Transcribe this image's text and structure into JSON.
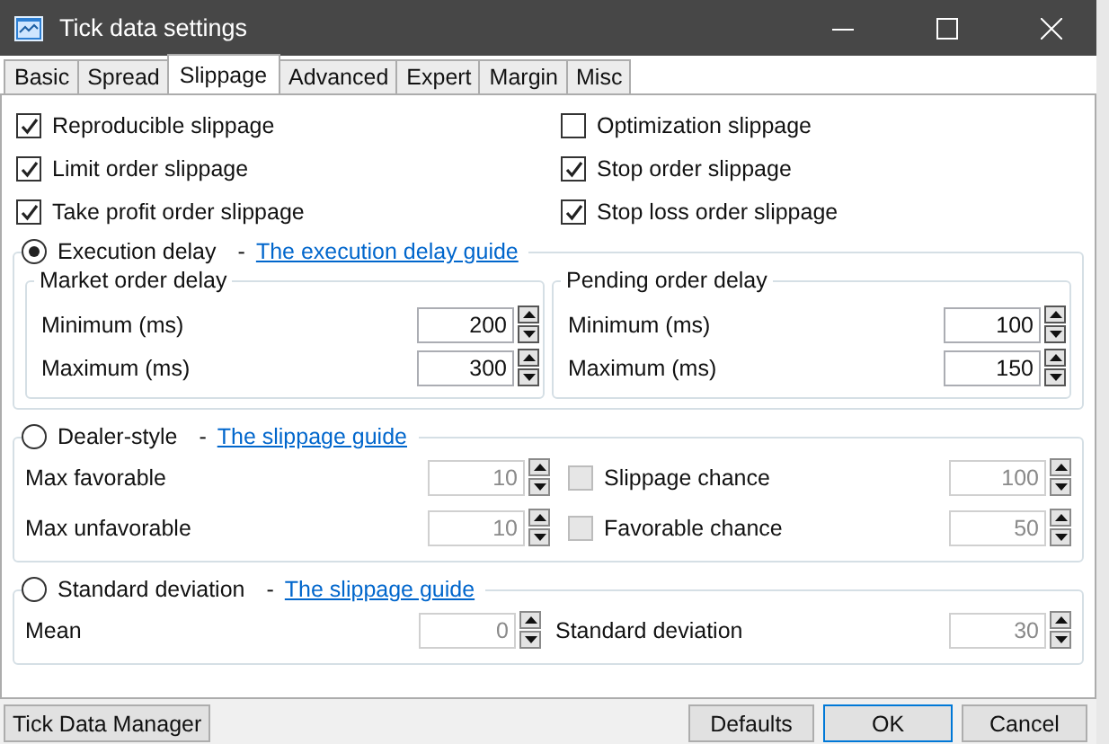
{
  "window": {
    "title": "Tick data settings"
  },
  "tabs": [
    {
      "label": "Basic",
      "selected": false
    },
    {
      "label": "Spread",
      "selected": false
    },
    {
      "label": "Slippage",
      "selected": true
    },
    {
      "label": "Advanced",
      "selected": false
    },
    {
      "label": "Expert",
      "selected": false
    },
    {
      "label": "Margin",
      "selected": false
    },
    {
      "label": "Misc",
      "selected": false
    }
  ],
  "checkboxes": [
    {
      "label": "Reproducible slippage",
      "checked": true
    },
    {
      "label": "Optimization slippage",
      "checked": false
    },
    {
      "label": "Limit order slippage",
      "checked": true
    },
    {
      "label": "Stop order slippage",
      "checked": true
    },
    {
      "label": "Take profit order slippage",
      "checked": true
    },
    {
      "label": "Stop loss order slippage",
      "checked": true
    }
  ],
  "modes": [
    {
      "kind": "delay",
      "label": "Execution delay",
      "selected": true,
      "separator": "-",
      "guide_link": "The execution delay guide",
      "groups": [
        {
          "title": "Market order delay",
          "fields": [
            {
              "label": "Minimum (ms)",
              "value": "200"
            },
            {
              "label": "Maximum (ms)",
              "value": "300"
            }
          ]
        },
        {
          "title": "Pending order delay",
          "fields": [
            {
              "label": "Minimum (ms)",
              "value": "100"
            },
            {
              "label": "Maximum (ms)",
              "value": "150"
            }
          ]
        }
      ]
    },
    {
      "kind": "dealer",
      "label": "Dealer-style",
      "selected": false,
      "separator": "-",
      "guide_link": "The slippage guide",
      "rows": [
        {
          "label": "Max favorable",
          "value": "10",
          "option": {
            "label": "Slippage chance",
            "checked": false
          },
          "option_value": "100"
        },
        {
          "label": "Max unfavorable",
          "value": "10",
          "option": {
            "label": "Favorable chance",
            "checked": false
          },
          "option_value": "50"
        }
      ]
    },
    {
      "kind": "deviation",
      "label": "Standard deviation",
      "selected": false,
      "separator": "-",
      "guide_link": "The slippage guide",
      "fields": [
        {
          "label": "Mean",
          "value": "0"
        },
        {
          "label": "Standard deviation",
          "value": "30"
        }
      ]
    }
  ],
  "buttons": [
    {
      "label": "Tick Data Manager",
      "default": false
    },
    {
      "label": "Defaults",
      "default": false
    },
    {
      "label": "OK",
      "default": true
    },
    {
      "label": "Cancel",
      "default": false
    }
  ]
}
